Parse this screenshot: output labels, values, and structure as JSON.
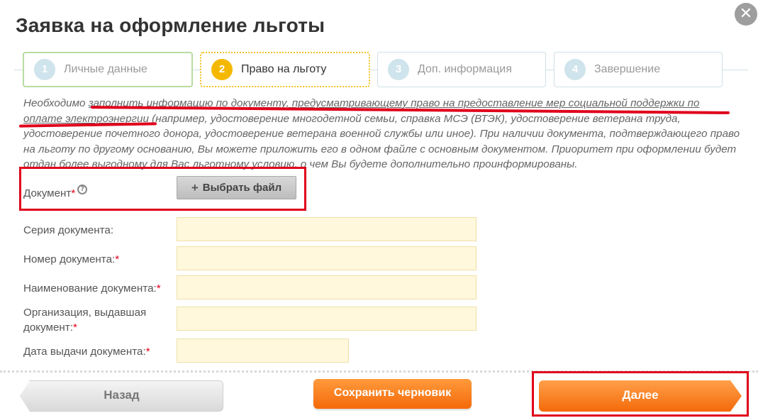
{
  "dialog": {
    "title": "Заявка на оформление льготы",
    "close_symbol": "✕"
  },
  "steps": [
    {
      "num": "1",
      "label": "Личные данные",
      "state": "done"
    },
    {
      "num": "2",
      "label": "Право на льготу",
      "state": "active"
    },
    {
      "num": "3",
      "label": "Доп. информация",
      "state": "pending"
    },
    {
      "num": "4",
      "label": "Завершение",
      "state": "pending"
    }
  ],
  "info": {
    "prefix": "Необходимо ",
    "underlined": "заполнить информацию по документу, предусматривающему право на предоставление мер социальной поддержки по оплате электроэнергии",
    "rest": " (например, удостоверение многодетной семьи, справка МСЭ (ВТЭК), удостоверение ветерана труда, удостоверение почетного донора, удостоверение ветерана военной службы или иное). При наличии документа, подтверждающего право на льготу по другому основанию, Вы можете приложить его в одном файле с основным документом. Приоритет при оформлении будет отдан более выгодному для Вас льготному условию, о чем Вы будете дополнительно проинформированы."
  },
  "form": {
    "document_label": "Документ",
    "help_symbol": "?",
    "file_button_icon": "+",
    "file_button_label": "Выбрать файл",
    "series_label": "Серия документа:",
    "number_label": "Номер документа:",
    "name_label": "Наименование документа:",
    "org_label": "Организация, выдавшая документ:",
    "date_label": "Дата выдачи документа:",
    "required_mark": "*",
    "series_value": "",
    "number_value": "",
    "name_value": "",
    "org_value": "",
    "date_value": ""
  },
  "buttons": {
    "back": "Назад",
    "save_draft": "Сохранить черновик",
    "next": "Далее"
  },
  "colors": {
    "annotation_red": "#e0001b",
    "accent_orange": "#f46a0a",
    "active_step": "#f5b800",
    "input_bg": "#fff8dc"
  }
}
